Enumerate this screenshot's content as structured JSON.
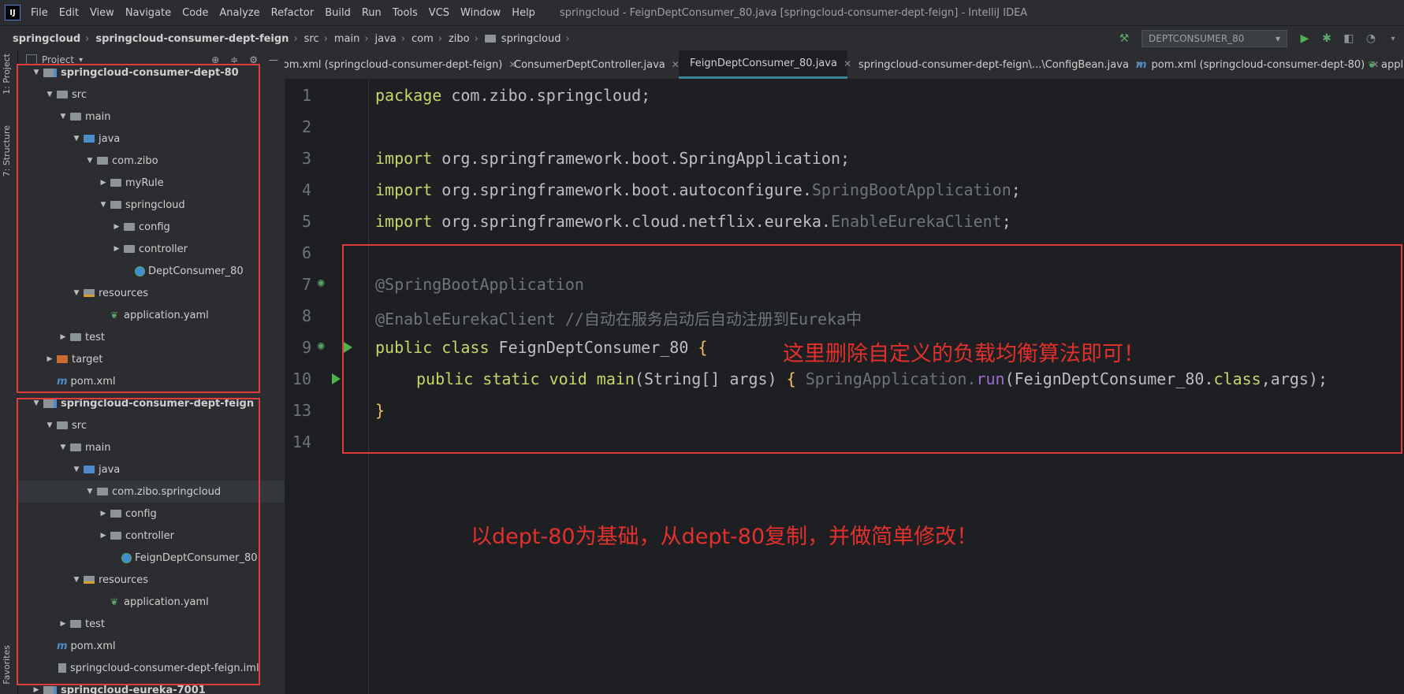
{
  "menubar": {
    "items": [
      "File",
      "Edit",
      "View",
      "Navigate",
      "Code",
      "Analyze",
      "Refactor",
      "Build",
      "Run",
      "Tools",
      "VCS",
      "Window",
      "Help"
    ],
    "window_title": "springcloud - FeignDeptConsumer_80.java [springcloud-consumer-dept-feign] - IntelliJ IDEA"
  },
  "breadcrumb": [
    "springcloud",
    "springcloud-consumer-dept-feign",
    "src",
    "main",
    "java",
    "com",
    "zibo",
    "springcloud"
  ],
  "run_config": {
    "label": "DEPTCONSUMER_80"
  },
  "side_tabs": {
    "project": "1: Project",
    "structure": "7: Structure",
    "favorites": "Favorites"
  },
  "project_panel": {
    "title": "Project",
    "tree": [
      {
        "label": "springcloud-consumer-dept-80",
        "bold": true
      },
      {
        "label": "src"
      },
      {
        "label": "main"
      },
      {
        "label": "java"
      },
      {
        "label": "com.zibo"
      },
      {
        "label": "myRule"
      },
      {
        "label": "springcloud"
      },
      {
        "label": "config"
      },
      {
        "label": "controller"
      },
      {
        "label": "DeptConsumer_80"
      },
      {
        "label": "resources"
      },
      {
        "label": "application.yaml"
      },
      {
        "label": "test"
      },
      {
        "label": "target"
      },
      {
        "label": "pom.xml"
      },
      {
        "label": "springcloud-consumer-dept-feign",
        "bold": true
      },
      {
        "label": "src"
      },
      {
        "label": "main"
      },
      {
        "label": "java"
      },
      {
        "label": "com.zibo.springcloud"
      },
      {
        "label": "config"
      },
      {
        "label": "controller"
      },
      {
        "label": "FeignDeptConsumer_80"
      },
      {
        "label": "resources"
      },
      {
        "label": "application.yaml"
      },
      {
        "label": "test"
      },
      {
        "label": "pom.xml"
      },
      {
        "label": "springcloud-consumer-dept-feign.iml"
      },
      {
        "label": "springcloud-eureka-7001",
        "bold": true
      }
    ]
  },
  "tabs": [
    {
      "label": "pom.xml (springcloud-consumer-dept-feign)",
      "icon": "maven-icon"
    },
    {
      "label": "ConsumerDeptController.java",
      "icon": "class-icon"
    },
    {
      "label": "FeignDeptConsumer_80.java",
      "icon": "spring-class-icon",
      "active": true
    },
    {
      "label": "springcloud-consumer-dept-feign\\...\\ConfigBean.java",
      "icon": "class-icon"
    },
    {
      "label": "pom.xml (springcloud-consumer-dept-80)",
      "icon": "maven-icon"
    },
    {
      "label": "appli",
      "icon": "yaml-icon"
    }
  ],
  "editor": {
    "line_numbers": [
      "1",
      "2",
      "3",
      "4",
      "5",
      "6",
      "7",
      "8",
      "9",
      "10",
      "13",
      "14"
    ],
    "lines": {
      "l1_kw": "package",
      "l1_rest": " com.zibo.springcloud;",
      "l3_kw": "import",
      "l3_rest": " org.springframework.boot.SpringApplication;",
      "l4_kw": "import",
      "l4_rest": " org.springframework.boot.autoconfigure.",
      "l4_gray": "SpringBootApplication",
      "l4_end": ";",
      "l5_kw": "import",
      "l5_rest": " org.springframework.cloud.netflix.eureka.",
      "l5_gray": "EnableEurekaClient",
      "l5_end": ";",
      "l7_ann": "@SpringBootApplication",
      "l8_ann": "@EnableEurekaClient",
      "l8_comment": " //自动在服务启动后自动注册到Eureka中",
      "l9_kw": "public class",
      "l9_name": " FeignDeptConsumer_80 ",
      "l9_brace": "{",
      "l10_kw": "public static void",
      "l10_name": " main",
      "l10_params": "(String[] args) ",
      "l10_brace": "{",
      "l10_call_a": " SpringApplication.",
      "l10_call_b": "run",
      "l10_call_c": "(FeignDeptConsumer_80.",
      "l10_call_d": "class",
      "l10_call_e": ",args);",
      "l13_brace": "}"
    }
  },
  "annotations": {
    "top_note": "这里删除自定义的负载均衡算法即可！",
    "bottom_note": "以dept-80为基础，从dept-80复制，并做简单修改！",
    "color": "#e2302c"
  }
}
